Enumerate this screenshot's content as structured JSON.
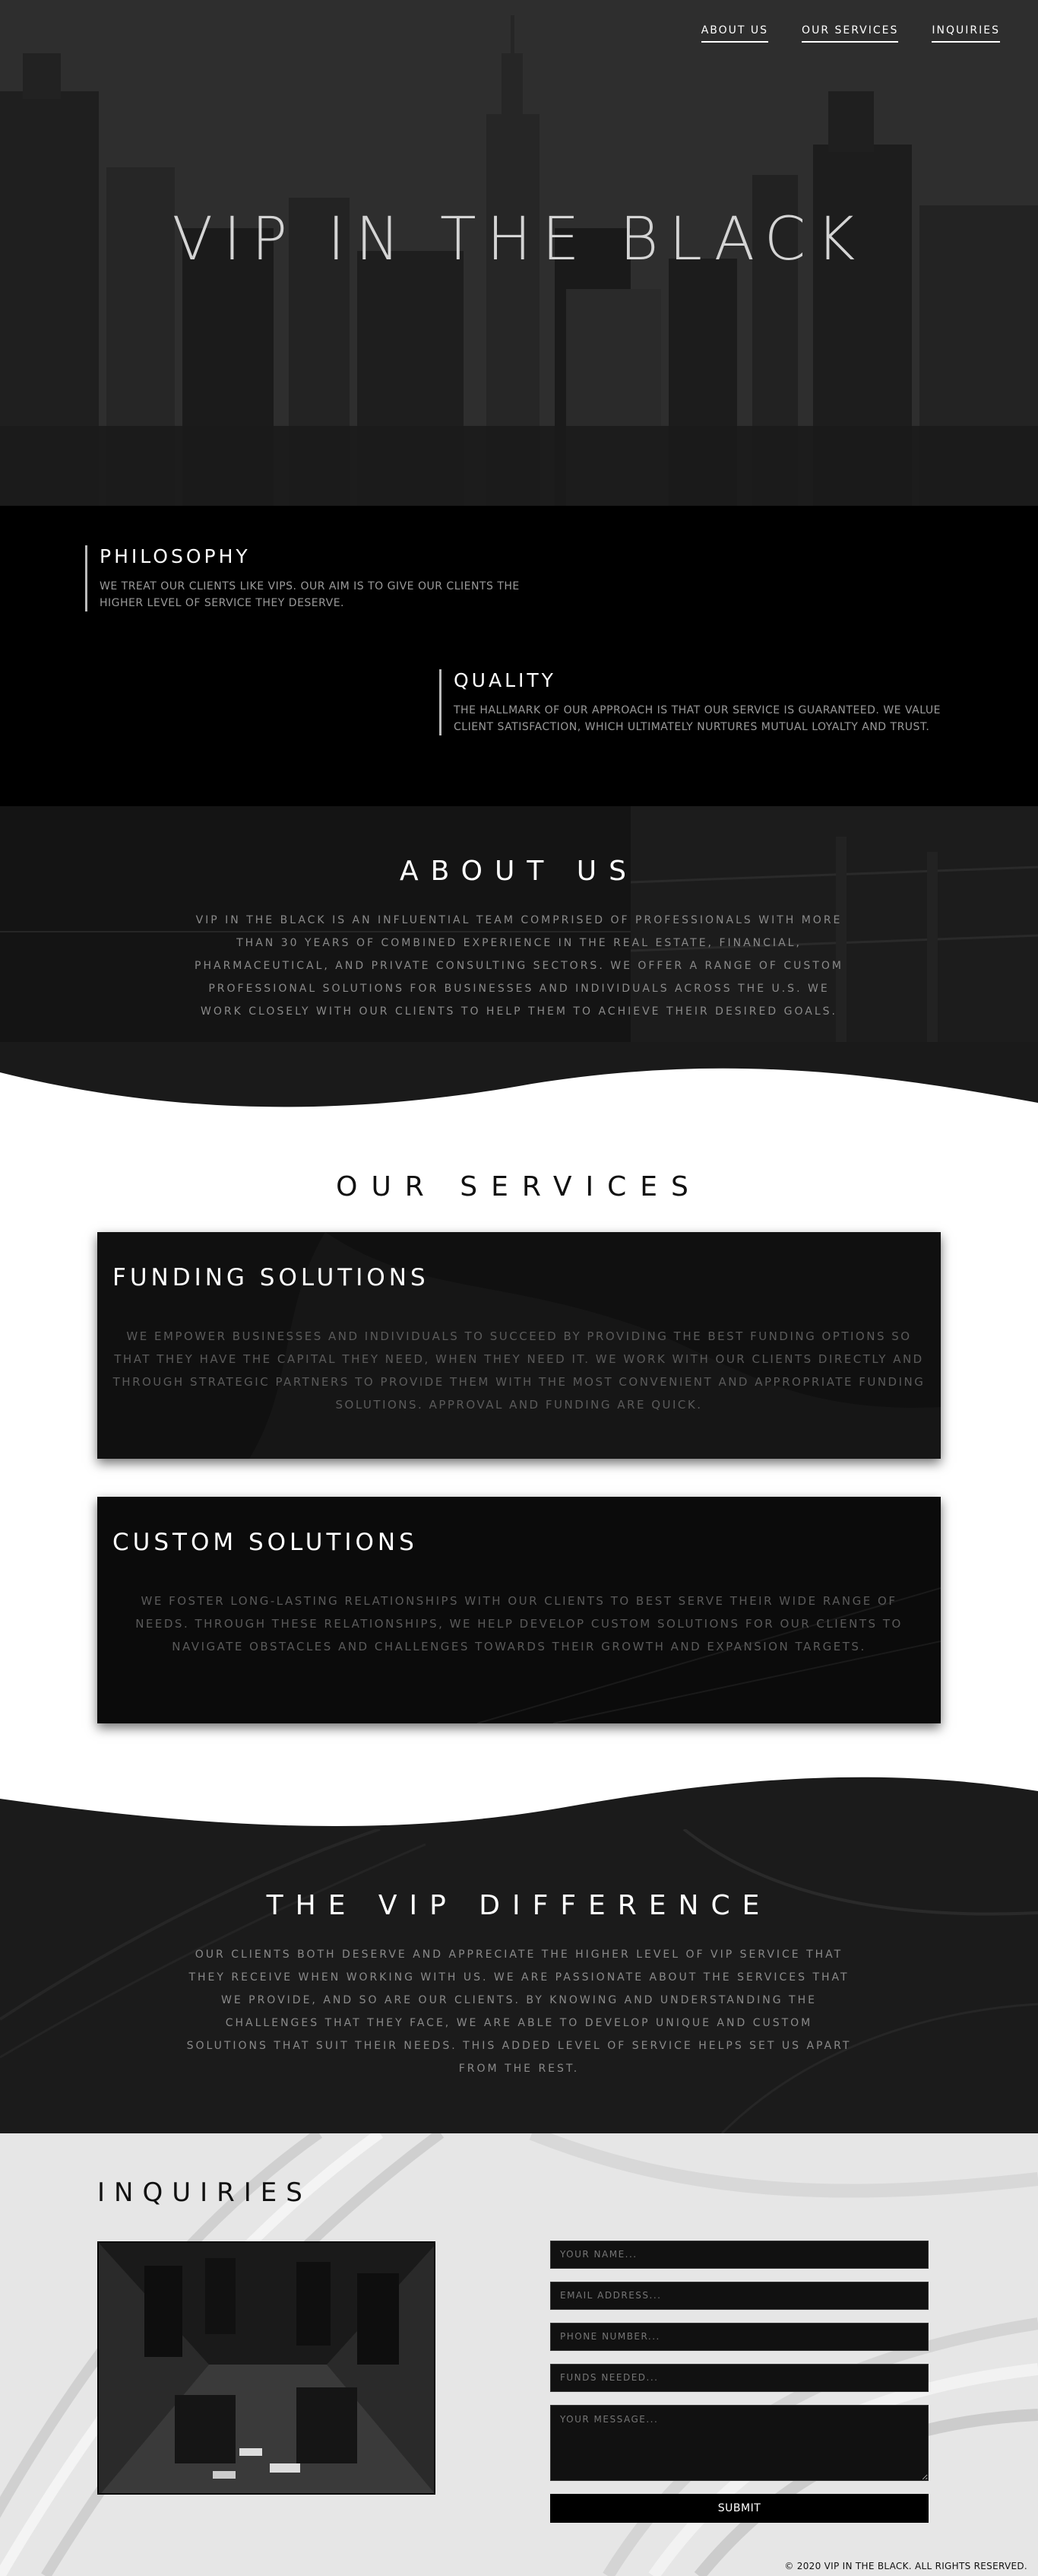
{
  "nav": {
    "items": [
      {
        "label": "ABOUT US"
      },
      {
        "label": "OUR SERVICES"
      },
      {
        "label": "INQUIRIES"
      }
    ]
  },
  "hero": {
    "title": "VIP IN THE BLACK"
  },
  "values": {
    "philosophy": {
      "title": "PHILOSOPHY",
      "text": "WE TREAT OUR CLIENTS LIKE VIPS. OUR AIM IS TO GIVE OUR CLIENTS THE HIGHER LEVEL OF SERVICE THEY DESERVE."
    },
    "quality": {
      "title": "QUALITY",
      "text": "THE HALLMARK OF OUR APPROACH IS THAT OUR SERVICE IS GUARANTEED. WE VALUE CLIENT SATISFACTION, WHICH ULTIMATELY NURTURES MUTUAL LOYALTY AND TRUST."
    }
  },
  "about": {
    "title": "ABOUT US",
    "text": "VIP IN THE BLACK IS AN INFLUENTIAL TEAM COMPRISED OF PROFESSIONALS WITH MORE THAN 30 YEARS OF COMBINED EXPERIENCE IN THE REAL ESTATE, FINANCIAL, PHARMACEUTICAL, AND PRIVATE CONSULTING SECTORS. WE OFFER A RANGE OF CUSTOM PROFESSIONAL SOLUTIONS FOR BUSINESSES AND INDIVIDUALS ACROSS THE U.S. WE WORK CLOSELY WITH OUR CLIENTS TO HELP THEM TO ACHIEVE THEIR DESIRED GOALS."
  },
  "services": {
    "title": "OUR SERVICES",
    "items": [
      {
        "title": "FUNDING SOLUTIONS",
        "text": "WE EMPOWER BUSINESSES AND INDIVIDUALS TO SUCCEED BY PROVIDING THE BEST FUNDING OPTIONS SO THAT THEY HAVE THE CAPITAL THEY NEED, WHEN THEY NEED IT. WE WORK WITH OUR CLIENTS DIRECTLY AND THROUGH STRATEGIC PARTNERS TO PROVIDE THEM WITH THE MOST CONVENIENT AND APPROPRIATE FUNDING SOLUTIONS. APPROVAL AND FUNDING ARE QUICK."
      },
      {
        "title": "CUSTOM SOLUTIONS",
        "text": "WE FOSTER LONG-LASTING RELATIONSHIPS WITH OUR CLIENTS TO BEST SERVE THEIR WIDE RANGE OF NEEDS. THROUGH THESE RELATIONSHIPS, WE HELP DEVELOP CUSTOM SOLUTIONS FOR OUR CLIENTS TO NAVIGATE OBSTACLES AND CHALLENGES TOWARDS THEIR GROWTH AND EXPANSION TARGETS."
      }
    ]
  },
  "difference": {
    "title": "THE VIP DIFFERENCE",
    "text": "OUR CLIENTS BOTH DESERVE AND APPRECIATE THE HIGHER LEVEL OF VIP SERVICE THAT THEY RECEIVE WHEN WORKING WITH US. WE ARE PASSIONATE ABOUT THE SERVICES THAT WE PROVIDE, AND SO ARE OUR CLIENTS. BY KNOWING AND UNDERSTANDING THE CHALLENGES THAT THEY FACE, WE ARE ABLE TO DEVELOP UNIQUE AND CUSTOM SOLUTIONS THAT SUIT THEIR NEEDS. THIS ADDED LEVEL OF SERVICE HELPS SET US APART FROM THE REST."
  },
  "inquiries": {
    "title": "INQUIRIES",
    "form": {
      "name_placeholder": "YOUR NAME...",
      "email_placeholder": "EMAIL ADDRESS...",
      "phone_placeholder": "PHONE NUMBER...",
      "funds_placeholder": "FUNDS NEEDED...",
      "message_placeholder": "YOUR MESSAGE...",
      "submit_label": "SUBMIT"
    }
  },
  "footer": {
    "text": "© 2020 VIP IN THE BLACK. ALL RIGHTS RESERVED."
  },
  "colors": {
    "background_dark": "#000000",
    "accent_light": "#ffffff",
    "text_muted": "#8a8a8a"
  }
}
